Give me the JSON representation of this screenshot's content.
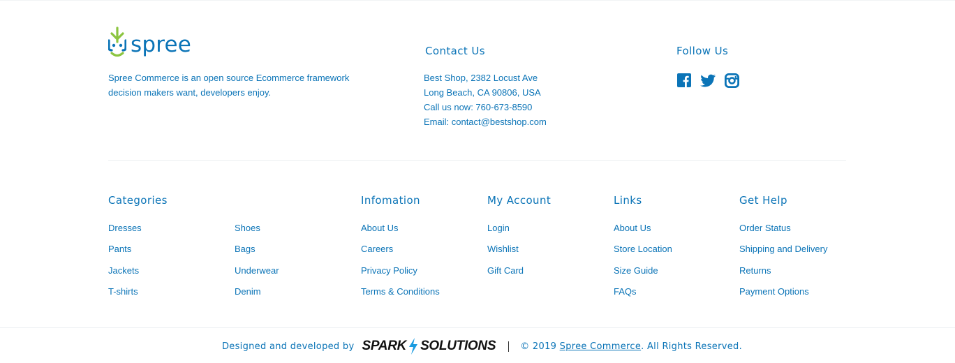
{
  "brand": {
    "name": "spree",
    "description": "Spree Commerce is an open source Ecommerce framework decision makers want, developers enjoy."
  },
  "contact": {
    "title": "Contact Us",
    "address_line1": "Best Shop, 2382 Locust Ave",
    "address_line2": "Long Beach, CA 90806, USA",
    "phone": "Call us now: 760-673-8590",
    "email": "Email: contact@bestshop.com"
  },
  "follow": {
    "title": "Follow Us",
    "icons": [
      "facebook-icon",
      "twitter-icon",
      "instagram-icon"
    ]
  },
  "categories": {
    "title": "Categories",
    "col1": [
      "Dresses",
      "Pants",
      "Jackets",
      "T-shirts"
    ],
    "col2": [
      "Shoes",
      "Bags",
      "Underwear",
      "Denim"
    ]
  },
  "information": {
    "title": "Infomation",
    "items": [
      "About Us",
      "Careers",
      "Privacy Policy",
      "Terms & Conditions"
    ]
  },
  "account": {
    "title": "My Account",
    "items": [
      "Login",
      "Wishlist",
      "Gift Card"
    ]
  },
  "links": {
    "title": "Links",
    "items": [
      "About Us",
      "Store Location",
      "Size Guide",
      "FAQs"
    ]
  },
  "help": {
    "title": "Get Help",
    "items": [
      "Order Status",
      "Shipping and Delivery",
      "Returns",
      "Payment Options"
    ]
  },
  "credits": {
    "designed_by": "Designed and developed by",
    "spark_left": "SPARK",
    "spark_right": "SOLUTIONS",
    "copyright_prefix": "© 2019",
    "copyright_link": "Spree Commerce",
    "copyright_suffix": ". All Rights Reserved."
  },
  "colors": {
    "accent": "#0b74b7",
    "logo_green": "#8cc540",
    "logo_blue": "#0b74b7",
    "divider": "#eceff2"
  }
}
